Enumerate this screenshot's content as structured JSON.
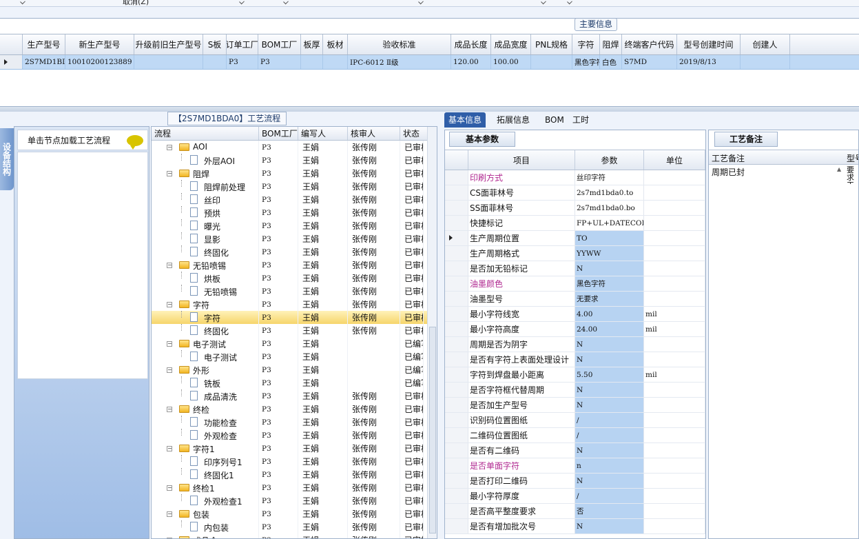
{
  "toolbar": {
    "cancel_label": "取消(Z)"
  },
  "main_info": {
    "title": "主要信息",
    "columns": [
      "生产型号",
      "新生产型号",
      "升级前旧生产型号",
      "S板",
      "订单工厂",
      "BOM工厂",
      "板厚",
      "板材",
      "验收标准",
      "成品长度",
      "成品宽度",
      "PNL规格",
      "字符",
      "阻焊",
      "终端客户代码",
      "型号创建时间",
      "创建人"
    ],
    "row": [
      "2S7MD1BDA0",
      "10010200123889",
      "",
      "",
      "P3",
      "P3",
      "",
      "",
      "IPC-6012 Ⅱ级",
      "120.00",
      "100.00",
      "",
      "黑色字符",
      "白色",
      "S7MD",
      "2019/8/13",
      ""
    ]
  },
  "left_panel": {
    "side_tab": "设备结构",
    "hint": "单击节点加载工艺流程"
  },
  "process": {
    "title": "【2S7MD1BDA0】工艺流程",
    "columns": [
      "流程",
      "BOM工厂",
      "编写人",
      "核审人",
      "状态"
    ],
    "rows": [
      {
        "name": "AOI",
        "level": 0,
        "bom": "P3",
        "writer": "王娟",
        "reviewer": "张传刚",
        "status": "已审核"
      },
      {
        "name": "外层AOI",
        "level": 1,
        "bom": "P3",
        "writer": "王娟",
        "reviewer": "张传刚",
        "status": "已审核"
      },
      {
        "name": "阻焊",
        "level": 0,
        "bom": "P3",
        "writer": "王娟",
        "reviewer": "张传刚",
        "status": "已审核"
      },
      {
        "name": "阻焊前处理",
        "level": 1,
        "bom": "P3",
        "writer": "王娟",
        "reviewer": "张传刚",
        "status": "已审核"
      },
      {
        "name": "丝印",
        "level": 1,
        "bom": "P3",
        "writer": "王娟",
        "reviewer": "张传刚",
        "status": "已审核"
      },
      {
        "name": "预烘",
        "level": 1,
        "bom": "P3",
        "writer": "王娟",
        "reviewer": "张传刚",
        "status": "已审核"
      },
      {
        "name": "曝光",
        "level": 1,
        "bom": "P3",
        "writer": "王娟",
        "reviewer": "张传刚",
        "status": "已审核"
      },
      {
        "name": "显影",
        "level": 1,
        "bom": "P3",
        "writer": "王娟",
        "reviewer": "张传刚",
        "status": "已审核"
      },
      {
        "name": "终固化",
        "level": 1,
        "bom": "P3",
        "writer": "王娟",
        "reviewer": "张传刚",
        "status": "已审核"
      },
      {
        "name": "无铅喷锡",
        "level": 0,
        "bom": "P3",
        "writer": "王娟",
        "reviewer": "张传刚",
        "status": "已审核"
      },
      {
        "name": "烘板",
        "level": 1,
        "bom": "P3",
        "writer": "王娟",
        "reviewer": "张传刚",
        "status": "已审核"
      },
      {
        "name": "无铅喷锡",
        "level": 1,
        "bom": "P3",
        "writer": "王娟",
        "reviewer": "张传刚",
        "status": "已审核"
      },
      {
        "name": "字符",
        "level": 0,
        "bom": "P3",
        "writer": "王娟",
        "reviewer": "张传刚",
        "status": "已审核"
      },
      {
        "name": "字符",
        "level": 1,
        "bom": "P3",
        "writer": "王娟",
        "reviewer": "张传刚",
        "status": "已审核",
        "selected": true
      },
      {
        "name": "终固化",
        "level": 1,
        "bom": "P3",
        "writer": "王娟",
        "reviewer": "张传刚",
        "status": "已审核"
      },
      {
        "name": "电子测试",
        "level": 0,
        "bom": "P3",
        "writer": "王娟",
        "reviewer": "",
        "status": "已编写"
      },
      {
        "name": "电子测试",
        "level": 1,
        "bom": "P3",
        "writer": "王娟",
        "reviewer": "",
        "status": "已编写"
      },
      {
        "name": "外形",
        "level": 0,
        "bom": "P3",
        "writer": "王娟",
        "reviewer": "",
        "status": "已编写"
      },
      {
        "name": "铣板",
        "level": 1,
        "bom": "P3",
        "writer": "王娟",
        "reviewer": "",
        "status": "已编写"
      },
      {
        "name": "成品清洗",
        "level": 1,
        "bom": "P3",
        "writer": "王娟",
        "reviewer": "张传刚",
        "status": "已审核"
      },
      {
        "name": "终检",
        "level": 0,
        "bom": "P3",
        "writer": "王娟",
        "reviewer": "张传刚",
        "status": "已审核"
      },
      {
        "name": "功能检查",
        "level": 1,
        "bom": "P3",
        "writer": "王娟",
        "reviewer": "张传刚",
        "status": "已审核"
      },
      {
        "name": "外观检查",
        "level": 1,
        "bom": "P3",
        "writer": "王娟",
        "reviewer": "张传刚",
        "status": "已审核"
      },
      {
        "name": "字符1",
        "level": 0,
        "bom": "P3",
        "writer": "王娟",
        "reviewer": "张传刚",
        "status": "已审核"
      },
      {
        "name": "印序列号1",
        "level": 1,
        "bom": "P3",
        "writer": "王娟",
        "reviewer": "张传刚",
        "status": "已审核"
      },
      {
        "name": "终固化1",
        "level": 1,
        "bom": "P3",
        "writer": "王娟",
        "reviewer": "张传刚",
        "status": "已审核"
      },
      {
        "name": "终检1",
        "level": 0,
        "bom": "P3",
        "writer": "王娟",
        "reviewer": "张传刚",
        "status": "已审核"
      },
      {
        "name": "外观检查1",
        "level": 1,
        "bom": "P3",
        "writer": "王娟",
        "reviewer": "张传刚",
        "status": "已审核"
      },
      {
        "name": "包装",
        "level": 0,
        "bom": "P3",
        "writer": "王娟",
        "reviewer": "张传刚",
        "status": "已审核"
      },
      {
        "name": "内包装",
        "level": 1,
        "bom": "P3",
        "writer": "王娟",
        "reviewer": "张传刚",
        "status": "已审核"
      },
      {
        "name": "成品仓",
        "level": 0,
        "bom": "P3",
        "writer": "王娟",
        "reviewer": "张传刚",
        "status": "已审核"
      }
    ]
  },
  "right_tabs": [
    "基本信息",
    "拓展信息",
    "BOM",
    "工时"
  ],
  "basic_params": {
    "title": "基本参数",
    "columns": [
      "项目",
      "参数",
      "单位"
    ],
    "rows": [
      {
        "item": "印刷方式",
        "value": "丝印字符",
        "unit": "",
        "magenta": true,
        "white": true
      },
      {
        "item": "CS面菲林号",
        "value": "2s7md1bda0.to",
        "unit": "",
        "white": true
      },
      {
        "item": "SS面菲林号",
        "value": "2s7md1bda0.bo",
        "unit": "",
        "white": true
      },
      {
        "item": "快捷标记",
        "value": "FP+UL+DATECODE",
        "unit": "",
        "white": true
      },
      {
        "item": "生产周期位置",
        "value": "TO",
        "unit": "",
        "current": true
      },
      {
        "item": "生产周期格式",
        "value": "YYWW",
        "unit": ""
      },
      {
        "item": "是否加无铅标记",
        "value": "N",
        "unit": ""
      },
      {
        "item": "油墨颜色",
        "value": "黑色字符",
        "unit": "",
        "magenta": true
      },
      {
        "item": "油墨型号",
        "value": "无要求",
        "unit": ""
      },
      {
        "item": "最小字符线宽",
        "value": "4.00",
        "unit": "mil"
      },
      {
        "item": "最小字符高度",
        "value": "24.00",
        "unit": "mil"
      },
      {
        "item": "周期是否为阴字",
        "value": "N",
        "unit": ""
      },
      {
        "item": "是否有字符上表面处理设计",
        "value": "N",
        "unit": ""
      },
      {
        "item": "字符到焊盘最小距离",
        "value": "5.50",
        "unit": "mil"
      },
      {
        "item": "是否字符框代替周期",
        "value": "N",
        "unit": ""
      },
      {
        "item": "是否加生产型号",
        "value": "N",
        "unit": ""
      },
      {
        "item": "识别码位置图纸",
        "value": "/",
        "unit": ""
      },
      {
        "item": "二维码位置图纸",
        "value": "/",
        "unit": ""
      },
      {
        "item": "是否有二维码",
        "value": "N",
        "unit": ""
      },
      {
        "item": "是否单面字符",
        "value": "n",
        "unit": "",
        "magenta": true
      },
      {
        "item": "是否打印二维码",
        "value": "N",
        "unit": ""
      },
      {
        "item": "最小字符厚度",
        "value": "/",
        "unit": ""
      },
      {
        "item": "是否高平整度要求",
        "value": "否",
        "unit": ""
      },
      {
        "item": "是否有增加批次号",
        "value": "N",
        "unit": ""
      }
    ]
  },
  "remarks": {
    "title": "工艺备注",
    "col1": "工艺备注",
    "col2": "型号",
    "value": "周期已封",
    "clip_text": "要求工艺"
  }
}
